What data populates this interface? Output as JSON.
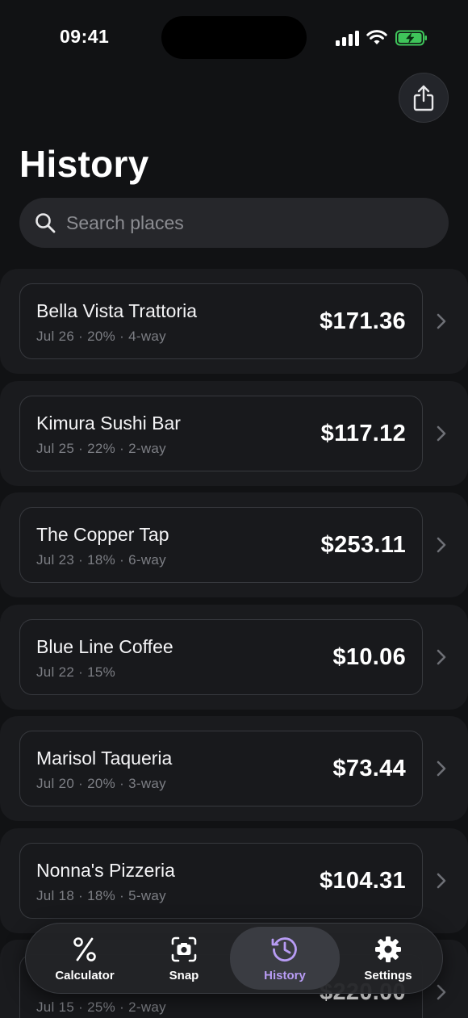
{
  "status_bar": {
    "time": "09:41"
  },
  "page": {
    "title": "History"
  },
  "search": {
    "placeholder": "Search places",
    "value": ""
  },
  "history": [
    {
      "name": "Bella Vista Trattoria",
      "meta": "Jul 26 · 20% · 4-way",
      "amount": "$171.36"
    },
    {
      "name": "Kimura Sushi Bar",
      "meta": "Jul 25 · 22% · 2-way",
      "amount": "$117.12"
    },
    {
      "name": "The Copper Tap",
      "meta": "Jul 23 · 18% · 6-way",
      "amount": "$253.11"
    },
    {
      "name": "Blue Line Coffee",
      "meta": "Jul 22 · 15%",
      "amount": "$10.06"
    },
    {
      "name": "Marisol Taqueria",
      "meta": "Jul 20 · 20% · 3-way",
      "amount": "$73.44"
    },
    {
      "name": "Nonna's Pizzeria",
      "meta": "Jul 18 · 18% · 5-way",
      "amount": "$104.31"
    },
    {
      "name": "",
      "meta": "Jul 15 · 25% · 2-way",
      "amount": "$220.00"
    }
  ],
  "tabs": [
    {
      "label": "Calculator",
      "icon": "percent-icon",
      "active": false
    },
    {
      "label": "Snap",
      "icon": "camera-scan-icon",
      "active": false
    },
    {
      "label": "History",
      "icon": "history-clock-icon",
      "active": true
    },
    {
      "label": "Settings",
      "icon": "gear-icon",
      "active": false
    }
  ],
  "colors": {
    "background": "#111214",
    "accent": "#b89cf5",
    "card": "#18191c"
  }
}
